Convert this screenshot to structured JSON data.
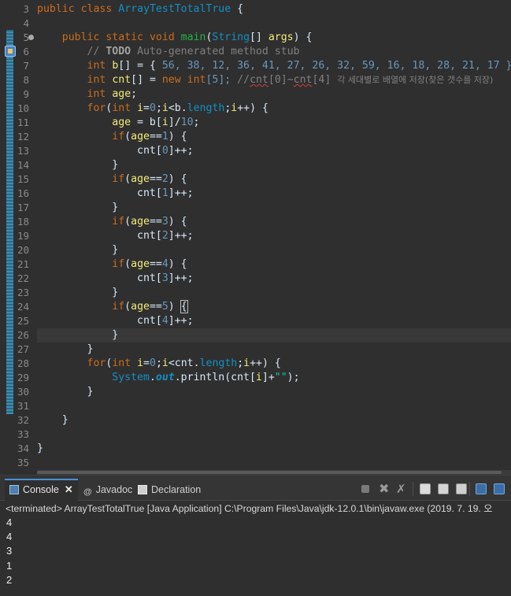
{
  "editor": {
    "line_numbers": [
      "3",
      "4",
      "5",
      "6",
      "7",
      "8",
      "9",
      "10",
      "11",
      "12",
      "13",
      "14",
      "15",
      "16",
      "17",
      "18",
      "19",
      "20",
      "21",
      "22",
      "23",
      "24",
      "25",
      "26",
      "27",
      "28",
      "29",
      "30",
      "31",
      "32",
      "33",
      "34",
      "35"
    ],
    "code": {
      "l3_public": "public",
      "l3_class": "class",
      "l3_name": "ArrayTestTotalTrue",
      "l3_brace": " {",
      "l5_public": "public",
      "l5_static": "static",
      "l5_void": "void",
      "l5_main": "main",
      "l5_paren": "(",
      "l5_string": "String",
      "l5_brackets": "[] ",
      "l5_args": "args",
      "l5_end": ") {",
      "l6_slashes": "// ",
      "l6_todo": "TODO",
      "l6_rest": " Auto-generated method stub",
      "l7_int": "int",
      "l7_b": "b",
      "l7_mid": "[] = { ",
      "l7_values": "56, 38, 12, 36, 41, 27, 26, 32, 59, 16, 18, 28, 21, 17 };",
      "l8_int": "int",
      "l8_cnt": "cnt",
      "l8_mid": "[] = ",
      "l8_new": "new",
      "l8_int2": "int",
      "l8_size": "[5]; ",
      "l8_comment_a": "//",
      "l8_comment_b": "cnt",
      "l8_comment_c": "[0]~",
      "l8_comment_d": "cnt",
      "l8_comment_e": "[4] ",
      "l8_korean": "각 세대별로 배열에 저장(찾은 갯수를 저장)",
      "l9_int": "int",
      "l9_age": "age",
      "l9_end": ";",
      "l10_for": "for",
      "l10_a": "(",
      "l10_int": "int",
      "l10_i": "i",
      "l10_b": "=",
      "l10_zero": "0",
      "l10_c": ";",
      "l10_i2": "i",
      "l10_d": "<b.",
      "l10_length": "length",
      "l10_e": ";",
      "l10_i3": "i",
      "l10_f": "++) {",
      "l11_age": "age",
      "l11_mid": " = b[",
      "l11_i": "i",
      "l11_div": "]/",
      "l11_ten": "10",
      "l11_end": ";",
      "if_kw": "if",
      "age_kw": "age",
      "eqeq": "==",
      "close_brace_open": ") {",
      "cnt_pre": "cnt[",
      "cnt_post": "]++;",
      "close_brace": "}",
      "l24_close": ") ",
      "l24_bracket": "{",
      "l28_cnt": "<cnt.",
      "l29_system": "System",
      "l29_dot": ".",
      "l29_out": "out",
      "l29_println": ".println(cnt[",
      "l29_i": "i",
      "l29_plus": "]+",
      "l29_str": "\"\"",
      "l29_end": ");"
    }
  },
  "console": {
    "tabs": {
      "console_label": "Console",
      "close_glyph": "✕",
      "javadoc_glyph": "@",
      "javadoc_label": "Javadoc",
      "declaration_label": "Declaration"
    },
    "status": "<terminated> ArrayTestTotalTrue [Java Application] C:\\Program Files\\Java\\jdk-12.0.1\\bin\\javaw.exe (2019. 7. 19. 오",
    "output": [
      "4",
      "4",
      "3",
      "1",
      "2"
    ],
    "toolbar_icons": [
      "terminate-icon",
      "remove-launch-icon",
      "remove-all-icon",
      "clear-console-icon",
      "scroll-lock-icon",
      "word-wrap-icon",
      "pin-console-icon",
      "display-console-icon"
    ]
  },
  "colors": {
    "background": "#2f2f2f",
    "keyword": "#cc6c1d",
    "class": "#1290c3",
    "method": "#1eb540",
    "variable": "#f3ec79",
    "number": "#6897bb",
    "comment": "#808080",
    "string": "#17c6a3"
  }
}
